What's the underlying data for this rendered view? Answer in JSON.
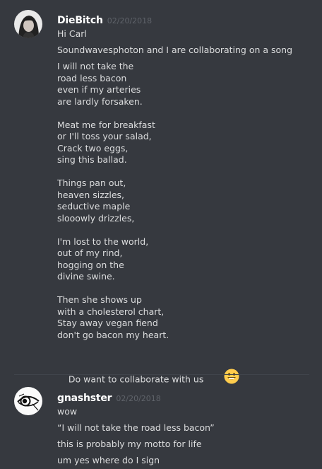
{
  "messages": [
    {
      "username": "DieBitch",
      "timestamp": "02/20/2018",
      "avatar": "woman-portrait-avatar",
      "lines": [
        "Hi Carl",
        "Soundwavesphoton and I are collaborating on a song",
        "I will not take the\nroad less bacon\neven if my arteries\nare lardly forsaken.\n\nMeat me for breakfast\nor I'll toss your salad,\nCrack two eggs,\nsing this ballad.\n\nThings pan out,\nheaven sizzles,\nseductive maple\nslooowly drizzles,\n\nI'm lost to the world,\nout of my rind,\nhogging on the\ndivine swine.\n\nThen she shows up\nwith a cholesterol chart,\nStay away vegan fiend\ndon't go bacon my heart.",
        "Do want to collaborate with us"
      ],
      "emoji": "smiley-emoji"
    },
    {
      "username": "gnashster",
      "timestamp": "02/20/2018",
      "avatar": "eye-drawing-avatar",
      "lines": [
        "wow",
        "“I will not take the road less bacon”",
        "this is probably my motto for life",
        "um yes where do I sign"
      ]
    }
  ]
}
